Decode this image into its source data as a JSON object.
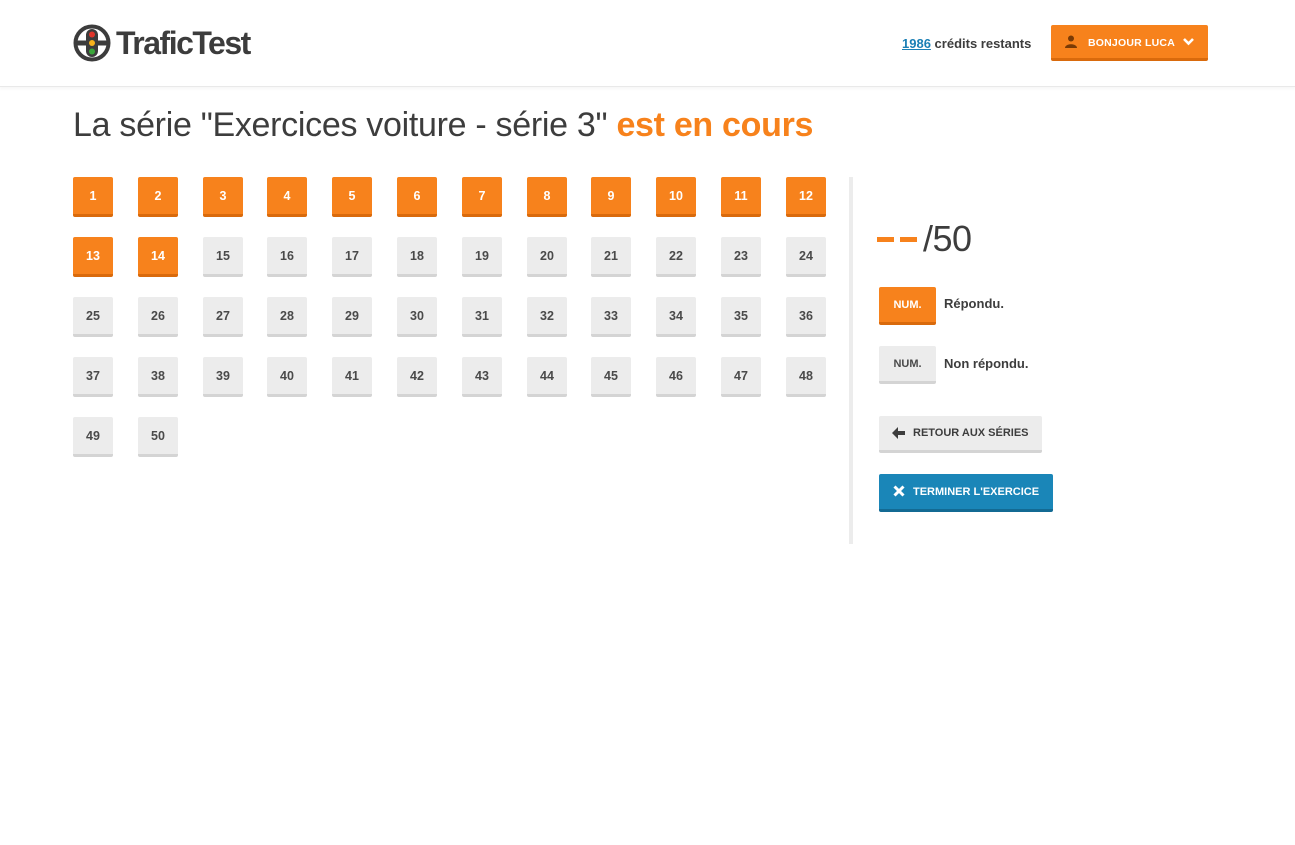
{
  "header": {
    "logo_text": "TraficTest",
    "credits_count": "1986",
    "credits_label": "crédits restants",
    "user_button_label": "BONJOUR LUCA"
  },
  "title": {
    "prefix": "La série \"Exercices voiture - série 3\"",
    "status": "est en cours"
  },
  "questions": {
    "total": 50,
    "answered": [
      1,
      2,
      3,
      4,
      5,
      6,
      7,
      8,
      9,
      10,
      11,
      12,
      13,
      14
    ]
  },
  "sidebar": {
    "score_value": "--",
    "score_total": "/50",
    "legend": {
      "answered_box": "NUM.",
      "answered_label": "Répondu.",
      "unanswered_box": "NUM.",
      "unanswered_label": "Non répondu."
    },
    "back_button_label": "RETOUR AUX SÉRIES",
    "finish_button_label": "TERMINER L'EXERCICE"
  },
  "colors": {
    "accent": "#f7821c",
    "accent_dark": "#d96a0c",
    "neutral": "#ececec",
    "primary": "#1a86b8",
    "link": "#1a7fb5"
  }
}
